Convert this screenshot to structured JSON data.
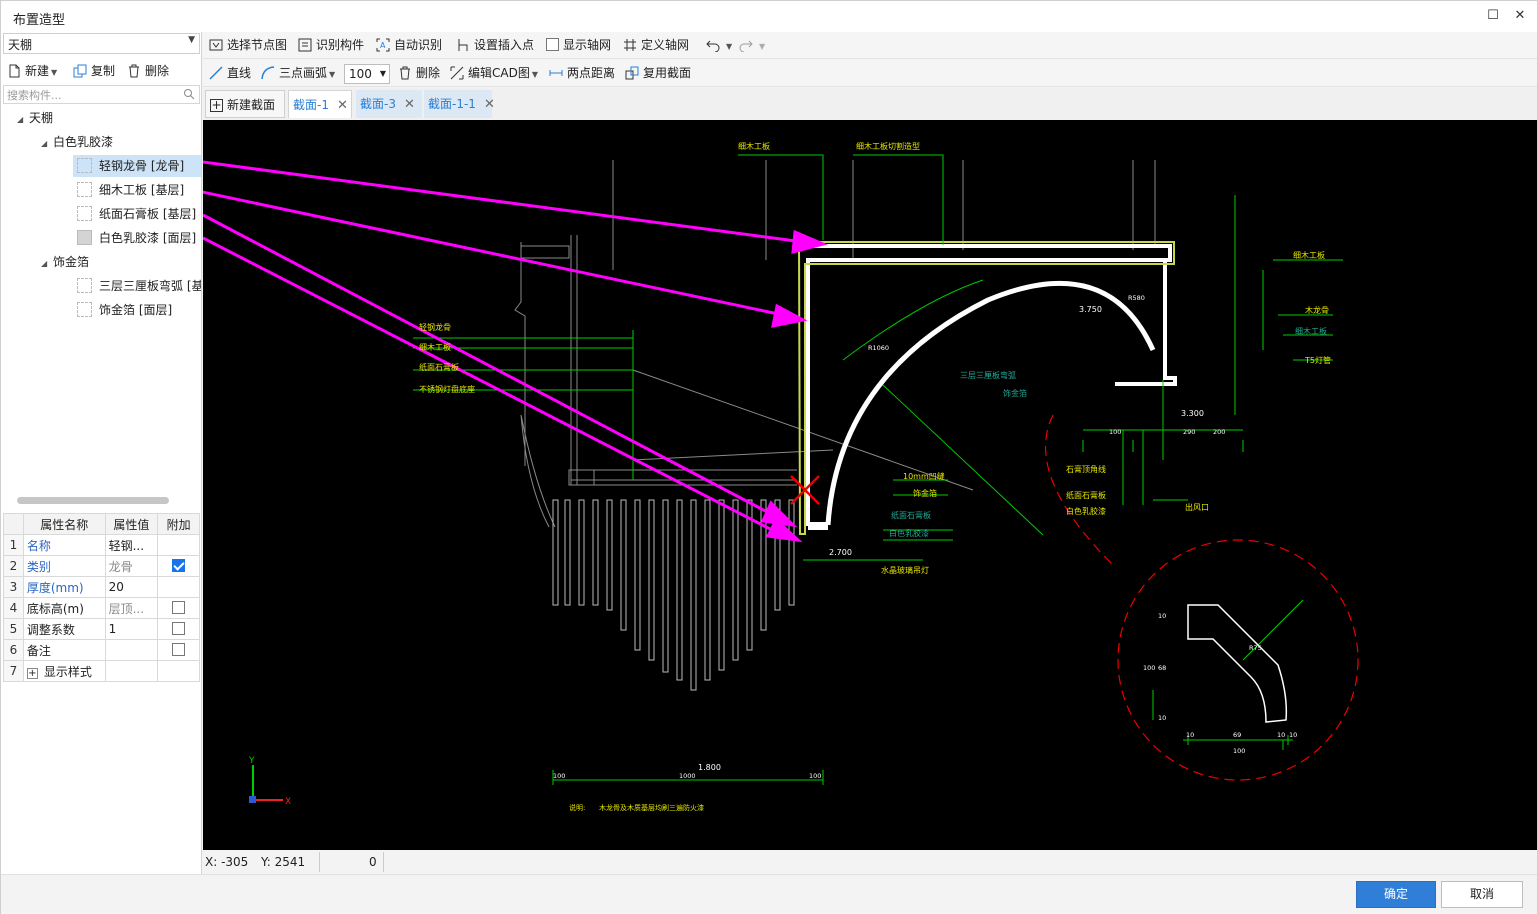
{
  "window": {
    "title": "布置造型"
  },
  "left": {
    "type_select": "天棚",
    "toolbar": {
      "new_label": "新建",
      "copy_label": "复制",
      "delete_label": "删除"
    },
    "search_placeholder": "搜索构件...",
    "tree": {
      "root": "天棚",
      "group1": "白色乳胶漆",
      "items1": [
        "轻钢龙骨 [龙骨]",
        "细木工板 [基层]",
        "纸面石膏板 [基层]",
        "白色乳胶漆 [面层]"
      ],
      "group2": "饰金箔",
      "items2": [
        "三层三厘板弯弧 [基",
        "饰金箔 [面层]"
      ]
    },
    "props": {
      "headers": [
        "属性名称",
        "属性值",
        "附加"
      ],
      "rows": [
        {
          "n": "1",
          "k": "名称",
          "v": "轻钢...",
          "checked": null
        },
        {
          "n": "2",
          "k": "类别",
          "v": "龙骨",
          "checked": true
        },
        {
          "n": "3",
          "k": "厚度(mm)",
          "v": "20",
          "checked": null
        },
        {
          "n": "4",
          "k": "底标高(m)",
          "v": "层顶...",
          "checked": false
        },
        {
          "n": "5",
          "k": "调整系数",
          "v": "1",
          "checked": false
        },
        {
          "n": "6",
          "k": "备注",
          "v": "",
          "checked": false
        },
        {
          "n": "7",
          "k": "显示样式",
          "v": "",
          "checked": null
        }
      ]
    }
  },
  "toolbar1": {
    "select_node": "选择节点图",
    "identify": "识别构件",
    "auto": "自动识别",
    "insert_point": "设置插入点",
    "show_axis": "显示轴网",
    "define_axis": "定义轴网"
  },
  "toolbar2": {
    "line": "直线",
    "arc": "三点画弧",
    "zoom": "100",
    "delete": "删除",
    "edit_cad": "编辑CAD图",
    "distance": "两点距离",
    "reuse": "复用截面"
  },
  "tabs": {
    "new": "新建截面",
    "items": [
      "截面-1",
      "截面-3",
      "截面-1-1"
    ]
  },
  "cad": {
    "labels_top": [
      "细木工板",
      "细木工板切割造型"
    ],
    "labels_right": [
      "细木工板",
      "木龙骨",
      "细木工板",
      "T5灯管"
    ],
    "labels_left": [
      "轻钢龙骨",
      "细木工板",
      "纸面石膏板",
      "不锈钢灯盘底座"
    ],
    "labels_mid": [
      "三层三厘板弯弧",
      "饰金箔",
      "10mm凹缝",
      "饰金箔",
      "纸面石膏板",
      "白色乳胶漆",
      "水晶玻璃吊灯"
    ],
    "labels_detail": [
      "石膏顶角线",
      "纸面石膏板",
      "白色乳胶漆",
      "出风口"
    ],
    "elev": [
      "3.750",
      "3.300",
      "2.700",
      "1.800"
    ],
    "dims": [
      "100",
      "290",
      "200",
      "100",
      "1000",
      "100",
      "10",
      "69",
      "10",
      "10",
      "100",
      "10",
      "68",
      "100",
      "10"
    ],
    "radii": [
      "R1060",
      "R580",
      "R75"
    ],
    "note_prefix": "说明:",
    "note": "木龙骨及木质基层均刷三遍防火漆"
  },
  "status": {
    "x": "X: -305",
    "y": "Y: 2541",
    "val": "0"
  },
  "footer": {
    "ok": "确定",
    "cancel": "取消"
  }
}
